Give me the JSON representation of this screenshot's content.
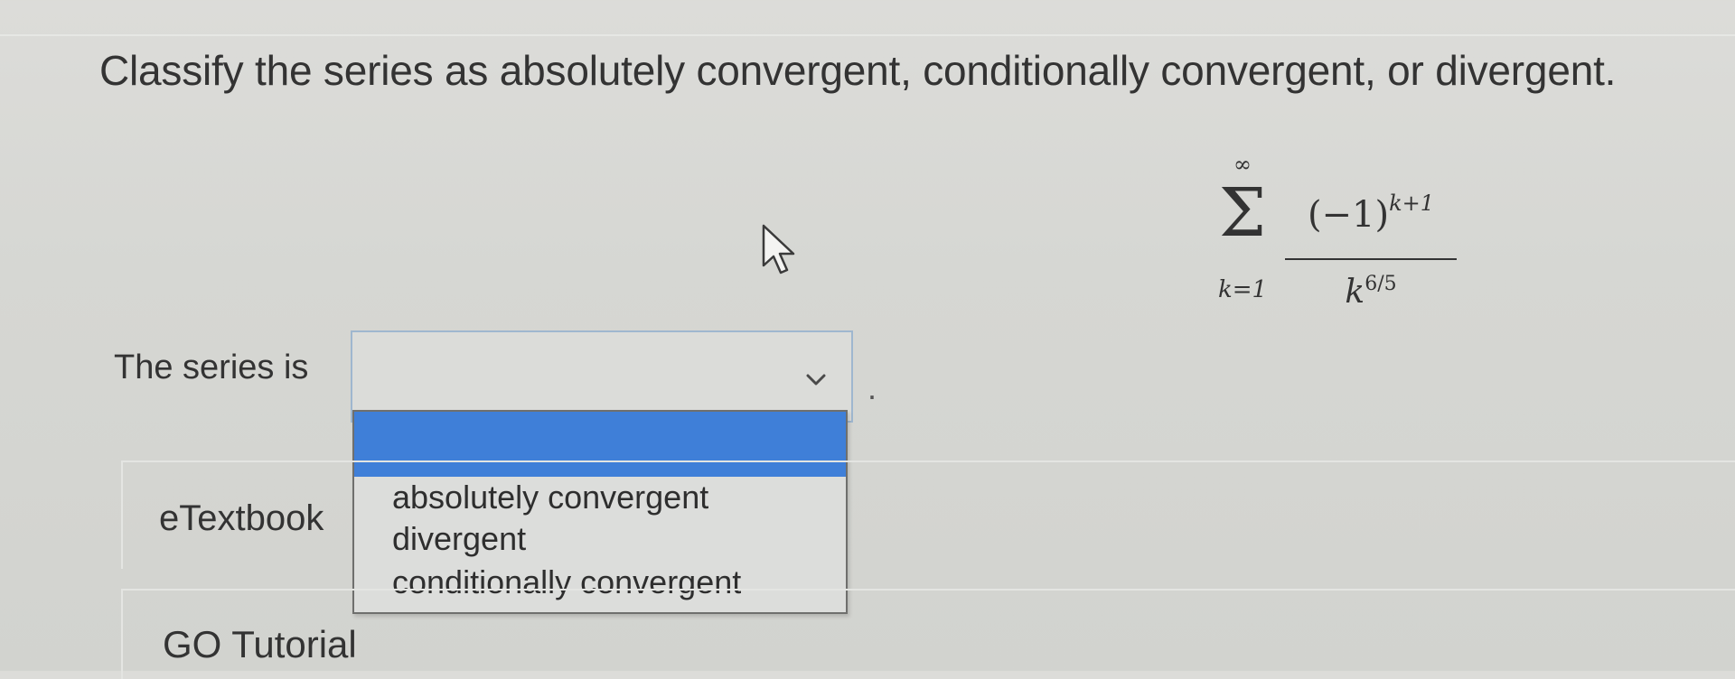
{
  "question": {
    "text": "Classify the series as absolutely convergent, conditionally convergent, or divergent."
  },
  "formula": {
    "sum_upper": "∞",
    "sum_symbol": "Σ",
    "sum_lower": "k=1",
    "numerator_base": "(−1)",
    "numerator_exponent": "k+1",
    "denominator_base": "k",
    "denominator_exponent": "6/5"
  },
  "answer": {
    "label": "The series is",
    "selected_value": "",
    "trailing_punct": ".",
    "options": [
      "absolutely convergent",
      "divergent",
      "conditionally convergent"
    ]
  },
  "links": {
    "etextbook": "eTextbook",
    "go_tutorial": "GO Tutorial"
  },
  "colors": {
    "highlight": "#3f7fd8",
    "select_border": "#9fb7cf"
  }
}
